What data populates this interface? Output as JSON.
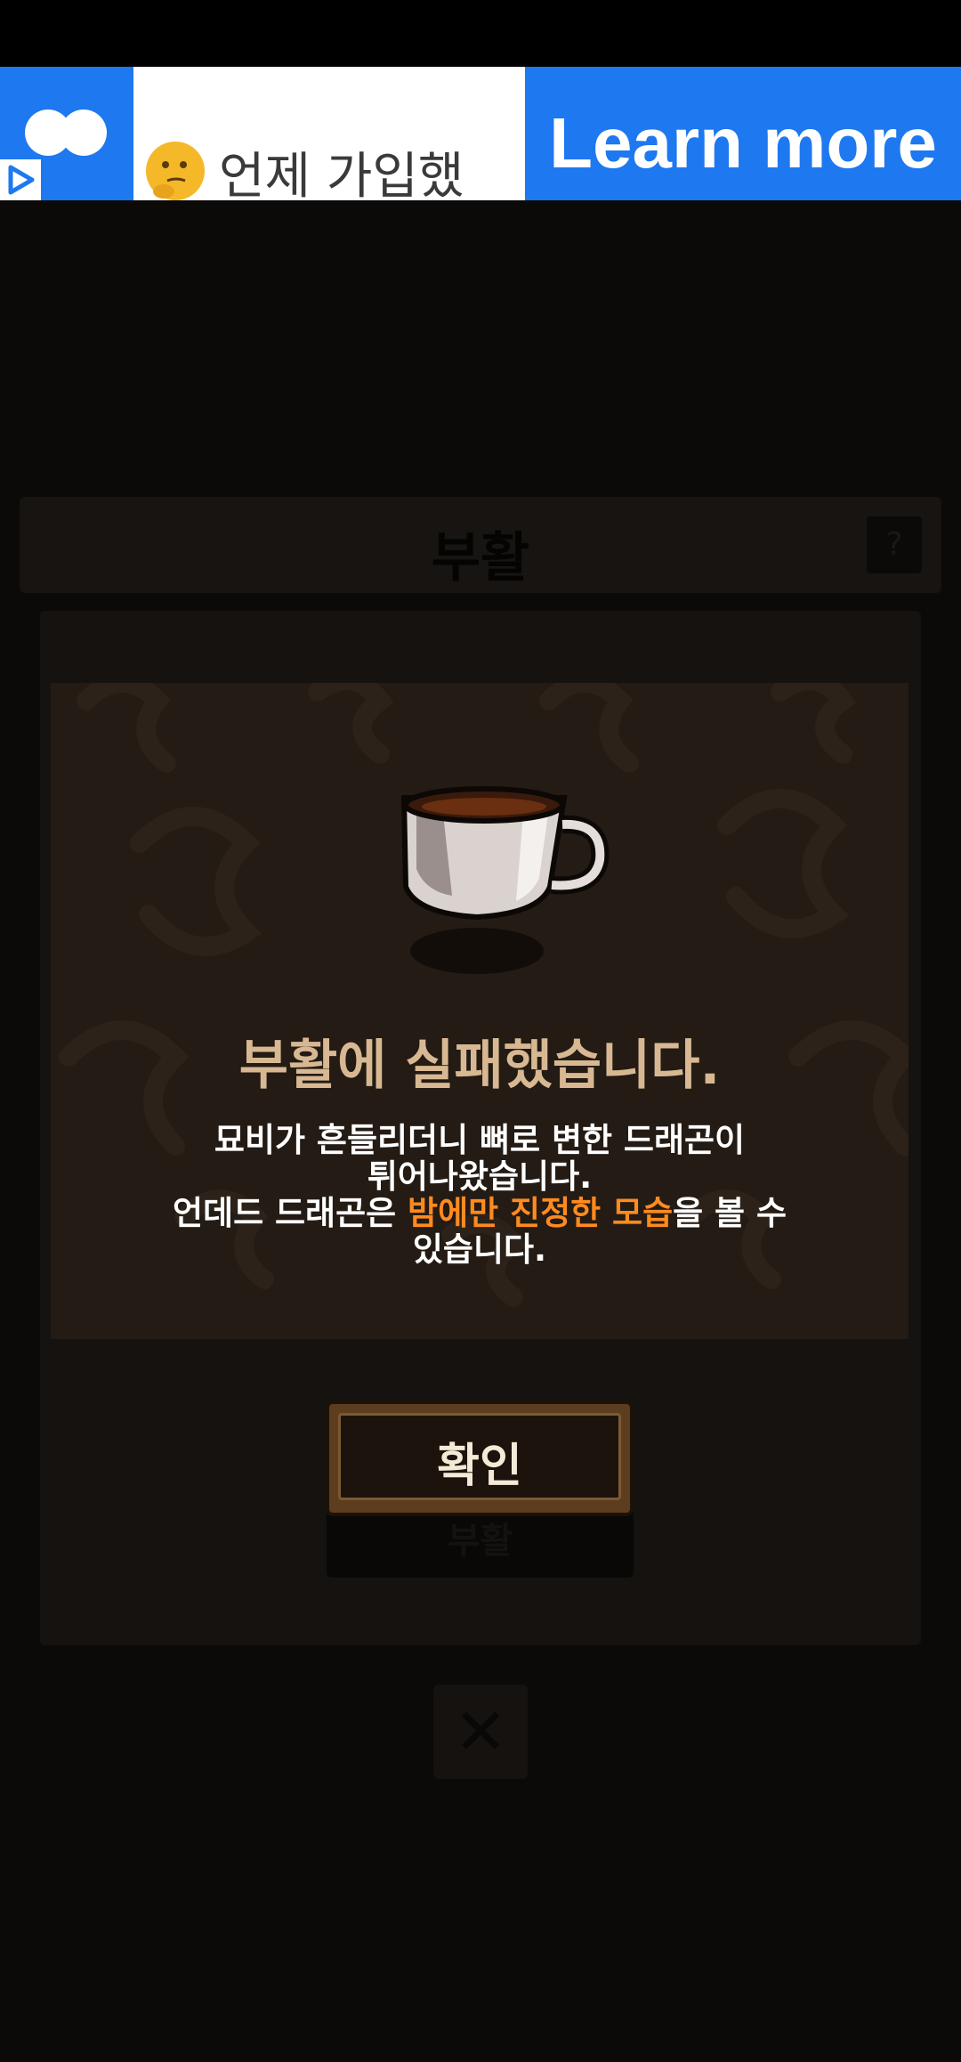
{
  "ad": {
    "headline": "언제 가입했",
    "cta": "Learn more"
  },
  "popup": {
    "title": "부활",
    "help": "?",
    "close": "✕"
  },
  "dialog": {
    "title": "부활에 실패했습니다.",
    "line1": "묘비가 흔들리더니 뼈로 변한 드래곤이",
    "line2": "튀어나왔습니다.",
    "line3_pre": "언데드 드래곤은 ",
    "line3_highlight": "밤에만 진정한 모습",
    "line3_post": "을 볼 수",
    "line4": "있습니다.",
    "confirm": "확인",
    "hidden_button": "부활"
  },
  "colors": {
    "ad_blue": "#1e78f0",
    "highlight": "#ff8a1f",
    "title": "#d8b893"
  },
  "icons": [
    "ad-logo-icon",
    "ad-play-icon",
    "thinking-emoji-icon",
    "help-icon",
    "coffee-cup-icon",
    "close-icon"
  ]
}
